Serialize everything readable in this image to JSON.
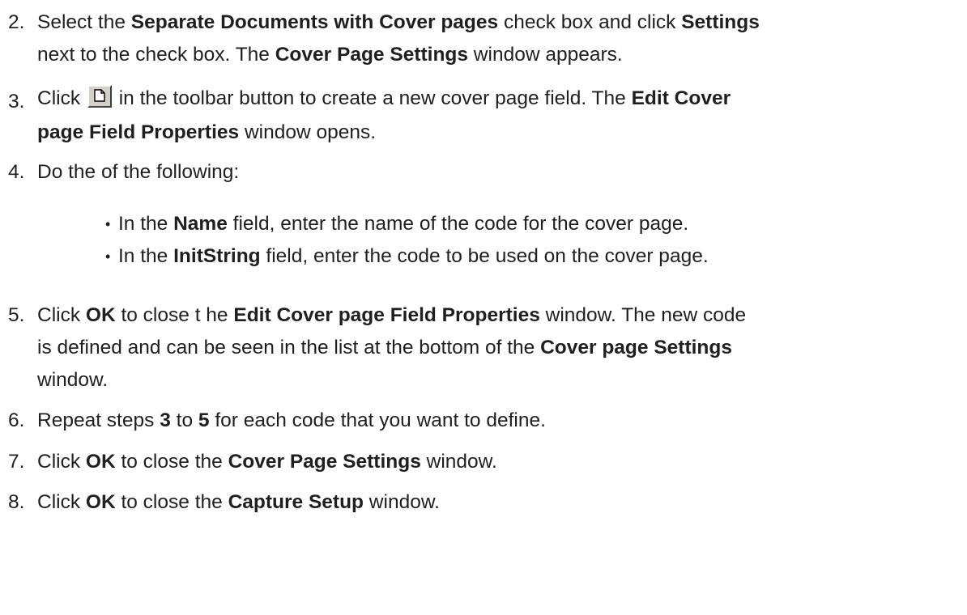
{
  "steps": [
    {
      "number": "2.",
      "lines": [
        [
          [
            "Select the ",
            false
          ],
          [
            "Separate Documents with Cover pages",
            true
          ],
          [
            " check box and click ",
            false
          ],
          [
            "Settings",
            true
          ]
        ],
        [
          [
            "next to the check box. The ",
            false
          ],
          [
            "Cover Page Settings",
            true
          ],
          [
            " window appears.",
            false
          ]
        ]
      ]
    },
    {
      "number": "3.",
      "line1_a": "Click ",
      "line1_b": " in the toolbar button to create a new cover page field. The ",
      "line1_c": "Edit Cover",
      "line2_a": "page Field Properties",
      "line2_b": " window opens."
    },
    {
      "number": "4.",
      "text": "Do the of the following:",
      "bullets": [
        {
          "a": "In the ",
          "b": "Name",
          "c": " field, enter the name of the code for the cover page."
        },
        {
          "a": "In the ",
          "b": "InitString",
          "c": " field, enter the code to be used on the cover page."
        }
      ]
    },
    {
      "number": "5.",
      "lines": [
        [
          [
            "Click ",
            false
          ],
          [
            "OK",
            true
          ],
          [
            " to close t he ",
            false
          ],
          [
            "Edit Cover page Field Properties",
            true
          ],
          [
            " window. The new code",
            false
          ]
        ],
        [
          [
            "is defined and can be seen in the list at the bottom of the ",
            false
          ],
          [
            "Cover page Settings",
            true
          ]
        ],
        [
          [
            "window.",
            false
          ]
        ]
      ]
    },
    {
      "number": "6.",
      "lines": [
        [
          [
            "Repeat steps ",
            false
          ],
          [
            "3",
            true
          ],
          [
            " to ",
            false
          ],
          [
            "5",
            true
          ],
          [
            " for each code that you want to define.",
            false
          ]
        ]
      ]
    },
    {
      "number": "7.",
      "lines": [
        [
          [
            "Click ",
            false
          ],
          [
            "OK",
            true
          ],
          [
            " to close the ",
            false
          ],
          [
            "Cover Page Settings",
            true
          ],
          [
            " window.",
            false
          ]
        ]
      ]
    },
    {
      "number": "8.",
      "lines": [
        [
          [
            "Click ",
            false
          ],
          [
            "OK",
            true
          ],
          [
            " to close the ",
            false
          ],
          [
            "Capture Setup",
            true
          ],
          [
            " window.",
            false
          ]
        ]
      ]
    }
  ],
  "icons": {
    "toolbar_button": "new-document-icon"
  }
}
